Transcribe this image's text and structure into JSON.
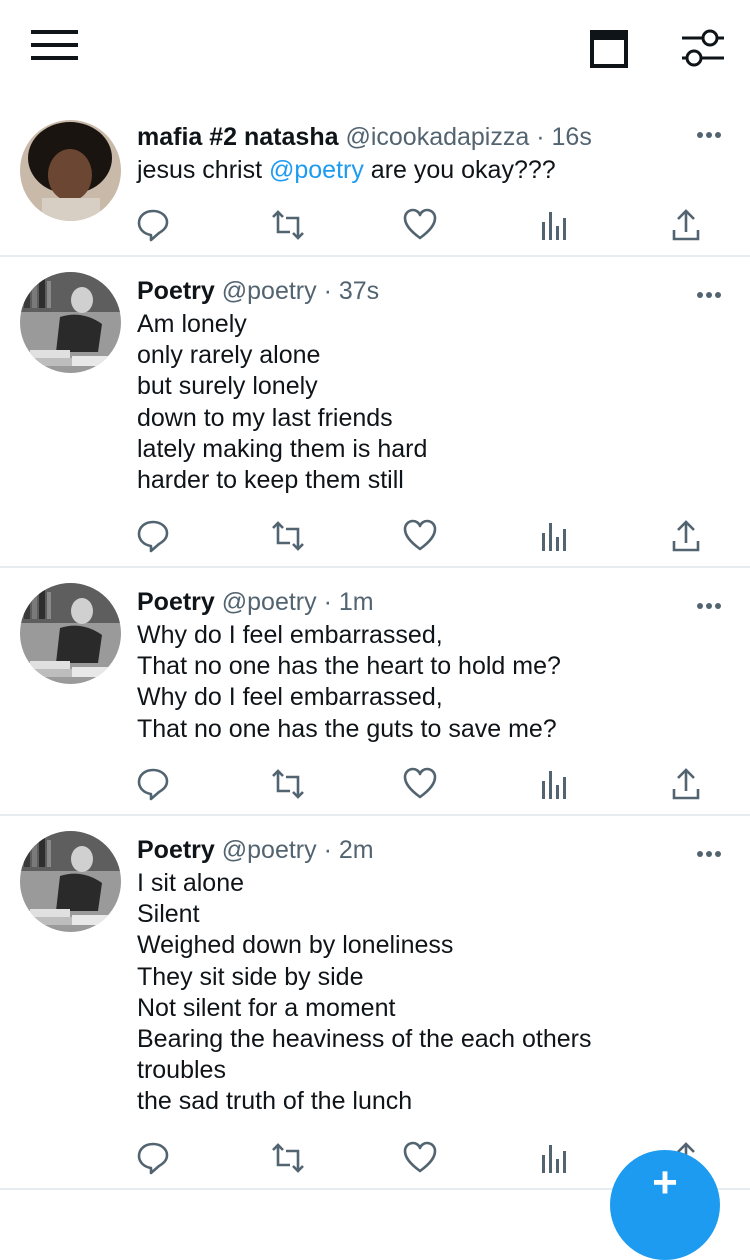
{
  "icons": {
    "menu": "hamburger-menu-icon",
    "calendar": "calendar-icon",
    "filter": "sliders-icon",
    "more": "more-dots-icon",
    "reply": "reply-icon",
    "retweet": "retweet-icon",
    "like": "heart-icon",
    "analytics": "analytics-icon",
    "share": "share-icon",
    "compose": "compose-plus-icon"
  },
  "colors": {
    "accent": "#1d9bf0",
    "text": "#0f1419",
    "muted": "#536471",
    "icon": "#536471",
    "divider": "#e6ecf0"
  },
  "tweets": [
    {
      "name": "mafia #2 natasha",
      "handle": "@icookadapizza",
      "separator": "·",
      "time": "16s",
      "text_before": "jesus christ ",
      "mention": "@poetry",
      "text_after": " are you okay???"
    },
    {
      "name": "Poetry",
      "handle": "@poetry",
      "separator": "·",
      "time": "37s",
      "lines": [
        "Am lonely",
        "only rarely alone",
        "but surely lonely",
        "down to my last friends",
        "lately making them is hard",
        "harder to keep them still"
      ]
    },
    {
      "name": "Poetry",
      "handle": "@poetry",
      "separator": "·",
      "time": "1m",
      "lines": [
        "Why do I feel embarrassed,",
        "That no one has the heart to hold me?",
        "Why do I feel embarrassed,",
        "That no one has the guts to save me?"
      ]
    },
    {
      "name": "Poetry",
      "handle": "@poetry",
      "separator": "·",
      "time": "2m",
      "lines": [
        "I sit alone",
        "Silent",
        "Weighed down by loneliness",
        "They sit side by side",
        "Not silent for a moment",
        "Bearing the heaviness of the each others",
        "troubles",
        "the sad truth of the lunch"
      ]
    }
  ],
  "compose": {
    "label": "+"
  }
}
